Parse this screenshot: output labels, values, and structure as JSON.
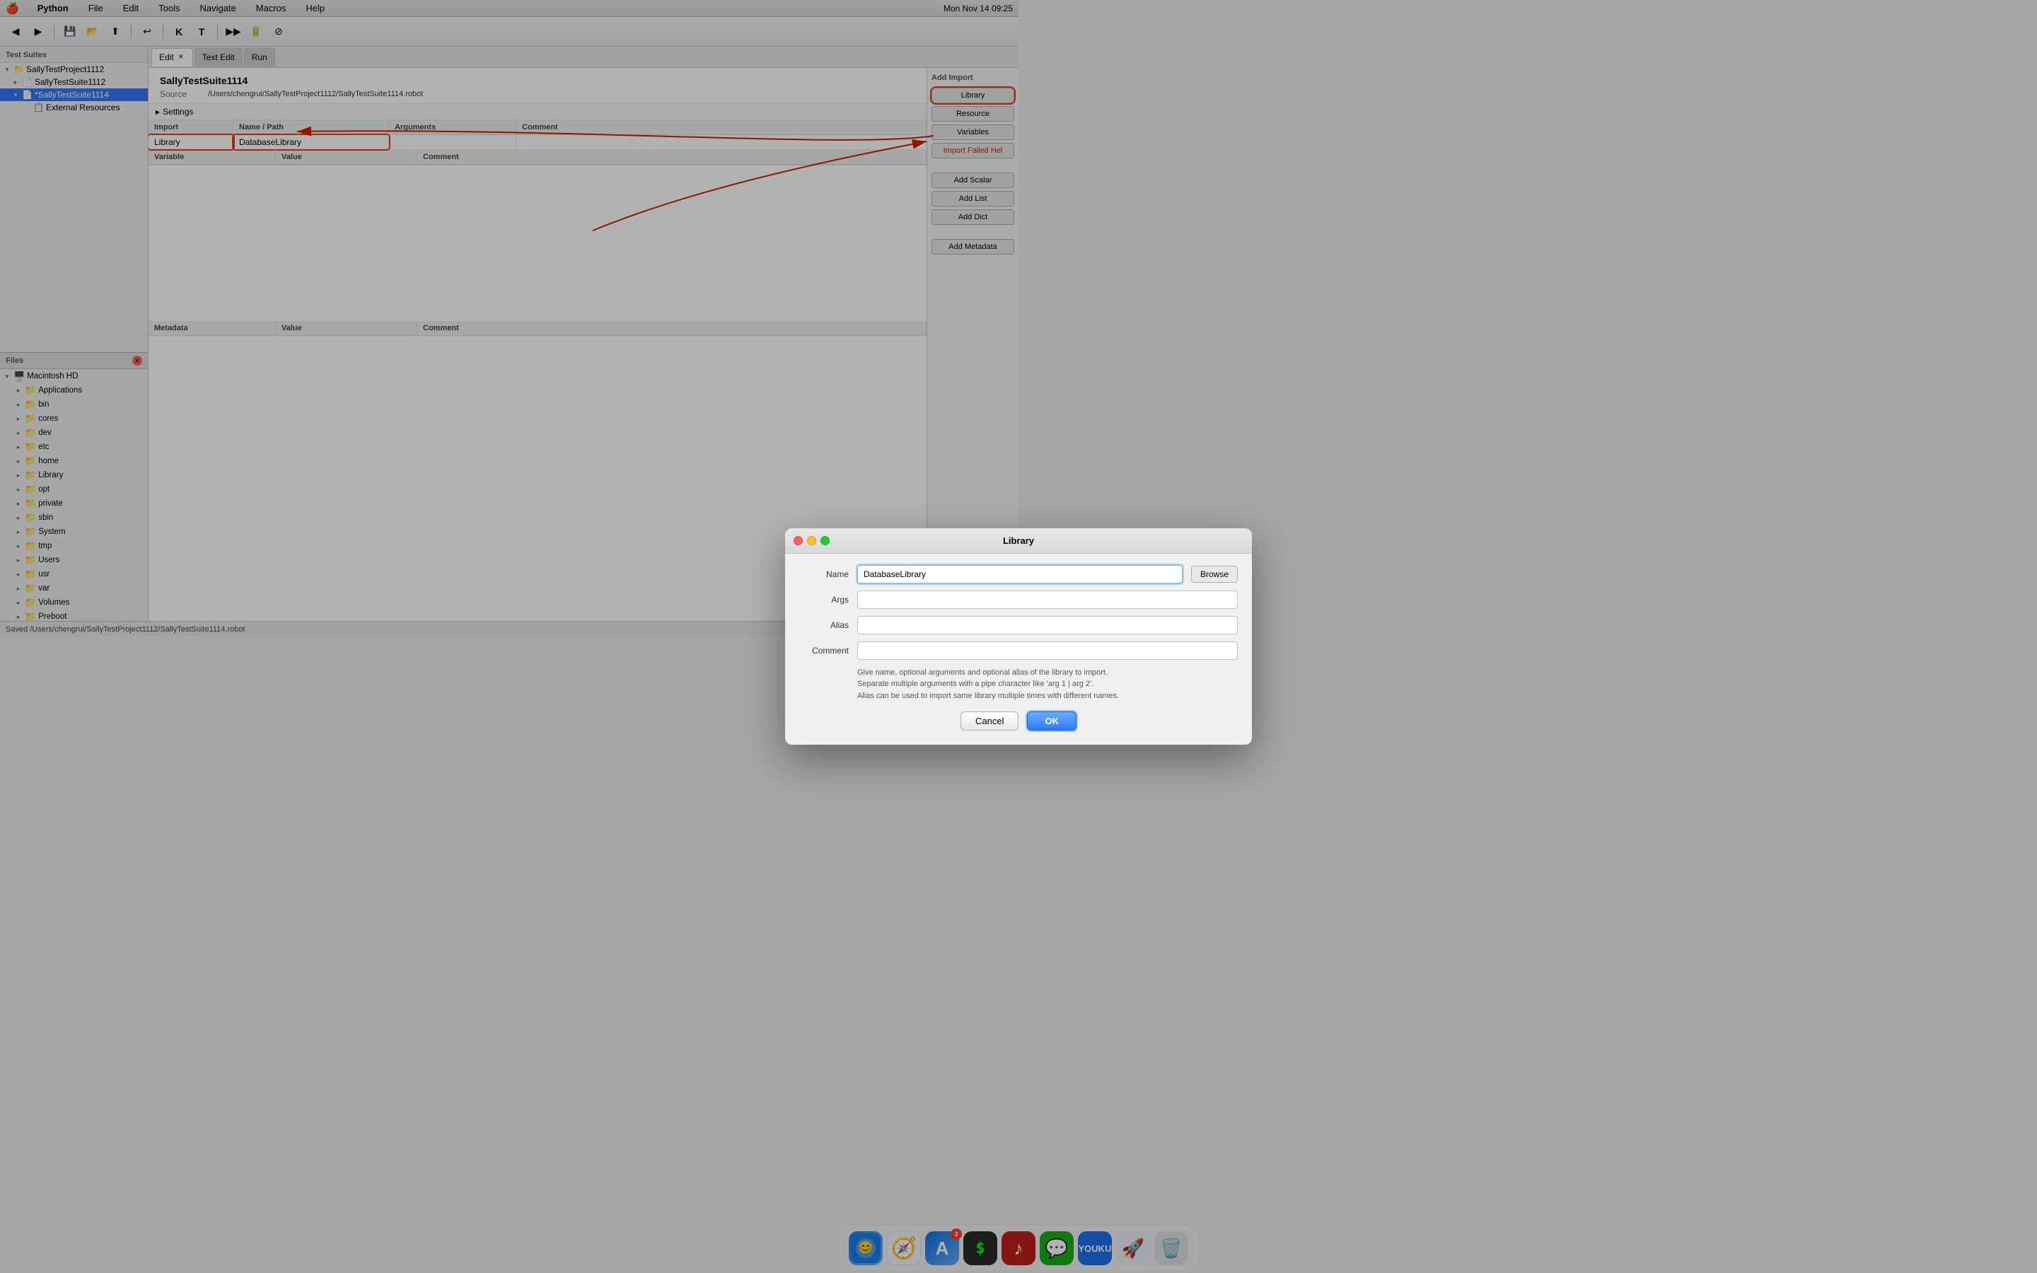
{
  "menubar": {
    "apple": "🍎",
    "items": [
      "Python",
      "File",
      "Edit",
      "Tools",
      "Navigate",
      "Macros",
      "Help"
    ],
    "right": {
      "time": "Mon Nov 14  09:25"
    }
  },
  "toolbar": {
    "buttons": [
      "◀",
      "▶",
      "💾",
      "📂",
      "⬆",
      "↩",
      "K",
      "T",
      "▶▶",
      "🔋",
      "⊘"
    ]
  },
  "left_panel": {
    "section_label": "Test Suites",
    "tree": [
      {
        "level": 0,
        "arrow": "▾",
        "icon": "📁",
        "label": "SallyTestProject1112",
        "expanded": true
      },
      {
        "level": 1,
        "arrow": "▸",
        "icon": "📄",
        "label": "SallyTestSuite1112"
      },
      {
        "level": 1,
        "arrow": "▾",
        "icon": "📄",
        "label": "*SallyTestSuite1114",
        "selected": true
      },
      {
        "level": 2,
        "arrow": "",
        "icon": "📋",
        "label": "External Resources"
      }
    ],
    "files_section": "Files",
    "macintosh_hd": "Macintosh HD",
    "file_items": [
      {
        "level": 1,
        "arrow": "▸",
        "icon": "📁",
        "label": "Applications"
      },
      {
        "level": 1,
        "arrow": "▸",
        "icon": "📁",
        "label": "bin"
      },
      {
        "level": 1,
        "arrow": "▸",
        "icon": "📁",
        "label": "cores"
      },
      {
        "level": 1,
        "arrow": "▸",
        "icon": "📁",
        "label": "dev"
      },
      {
        "level": 1,
        "arrow": "▸",
        "icon": "📁",
        "label": "etc"
      },
      {
        "level": 1,
        "arrow": "▸",
        "icon": "📁",
        "label": "home"
      },
      {
        "level": 1,
        "arrow": "▸",
        "icon": "📁",
        "label": "Library"
      },
      {
        "level": 1,
        "arrow": "▸",
        "icon": "📁",
        "label": "opt"
      },
      {
        "level": 1,
        "arrow": "▸",
        "icon": "📁",
        "label": "private"
      },
      {
        "level": 1,
        "arrow": "▸",
        "icon": "📁",
        "label": "sbin"
      },
      {
        "level": 1,
        "arrow": "▸",
        "icon": "📁",
        "label": "System"
      },
      {
        "level": 1,
        "arrow": "▸",
        "icon": "📁",
        "label": "tmp"
      },
      {
        "level": 1,
        "arrow": "▸",
        "icon": "📁",
        "label": "Users"
      },
      {
        "level": 1,
        "arrow": "▸",
        "icon": "📁",
        "label": "usr"
      },
      {
        "level": 1,
        "arrow": "▸",
        "icon": "📁",
        "label": "var"
      },
      {
        "level": 1,
        "arrow": "▸",
        "icon": "📁",
        "label": "Volumes"
      },
      {
        "level": 1,
        "arrow": "▸",
        "icon": "📁",
        "label": "Preboot"
      }
    ]
  },
  "tabs": [
    {
      "label": "Edit",
      "active": true,
      "closeable": true
    },
    {
      "label": "Text Edit",
      "active": false,
      "closeable": false
    },
    {
      "label": "Run",
      "active": false,
      "closeable": false
    }
  ],
  "suite": {
    "title": "SallyTestSuite1114",
    "source_label": "Source",
    "source_path": "/Users/chengrui/SallyTestProject1112/SallyTestSuite1114.robot"
  },
  "settings": {
    "toggle_label": "Settings",
    "import_section": {
      "headers": [
        "Import",
        "Name / Path",
        "Arguments",
        "Comment"
      ],
      "rows": [
        {
          "import": "Library",
          "name": "DatabaseLibrary",
          "args": "",
          "comment": ""
        }
      ]
    },
    "variables_section": {
      "headers": [
        "Variable",
        "Value",
        "Comment"
      ],
      "rows": []
    }
  },
  "metadata": {
    "headers": [
      "Metadata",
      "Value",
      "Comment"
    ],
    "rows": []
  },
  "right_panel": {
    "add_import_label": "Add Import",
    "library_btn": "Library",
    "resource_btn": "Resource",
    "variables_btn": "Variables",
    "import_failed_btn": "Import Failed Hel",
    "add_scalar_btn": "Add Scalar",
    "add_list_btn": "Add List",
    "add_dict_btn": "Add Dict",
    "add_metadata_btn": "Add Metadata"
  },
  "modal": {
    "title": "Library",
    "traffic_lights": [
      "red",
      "yellow",
      "green"
    ],
    "fields": [
      {
        "label": "Name",
        "value": "DatabaseLibrary",
        "placeholder": ""
      },
      {
        "label": "Args",
        "value": "",
        "placeholder": ""
      },
      {
        "label": "Alias",
        "value": "",
        "placeholder": ""
      },
      {
        "label": "Comment",
        "value": "",
        "placeholder": ""
      }
    ],
    "browse_btn": "Browse",
    "hint_lines": [
      "Give name, optional arguments and optional alias of the library to import.",
      "Separate multiple arguments with a pipe character like 'arg 1 | arg 2'.",
      "Alias can be used to import same library multiple times with different names."
    ],
    "cancel_btn": "Cancel",
    "ok_btn": "OK"
  },
  "statusbar": {
    "text": "Saved /Users/chengrui/SallyTestProject1112/SallyTestSuite1114.robot"
  },
  "dock": {
    "items": [
      {
        "label": "Finder",
        "icon": "🔵",
        "bg": "#1a7de8",
        "badge": null
      },
      {
        "label": "Safari",
        "icon": "🧭",
        "bg": "#f0f0f0",
        "badge": null
      },
      {
        "label": "App Store",
        "icon": "🅰️",
        "bg": "#1472de",
        "badge": "3"
      },
      {
        "label": "Terminal",
        "icon": "⬛",
        "bg": "#2a2a2a",
        "badge": null
      },
      {
        "label": "NetEase Music",
        "icon": "🎵",
        "bg": "#c0201a",
        "badge": null
      },
      {
        "label": "WeChat",
        "icon": "💬",
        "bg": "#1aad19",
        "badge": null
      },
      {
        "label": "Youku",
        "icon": "▶",
        "bg": "#1e6fe8",
        "badge": null
      },
      {
        "label": "Rocket",
        "icon": "🚀",
        "bg": "#e8f0f8",
        "badge": null
      },
      {
        "label": "Trash",
        "icon": "🗑️",
        "bg": "#e8e8e8",
        "badge": null
      }
    ]
  }
}
